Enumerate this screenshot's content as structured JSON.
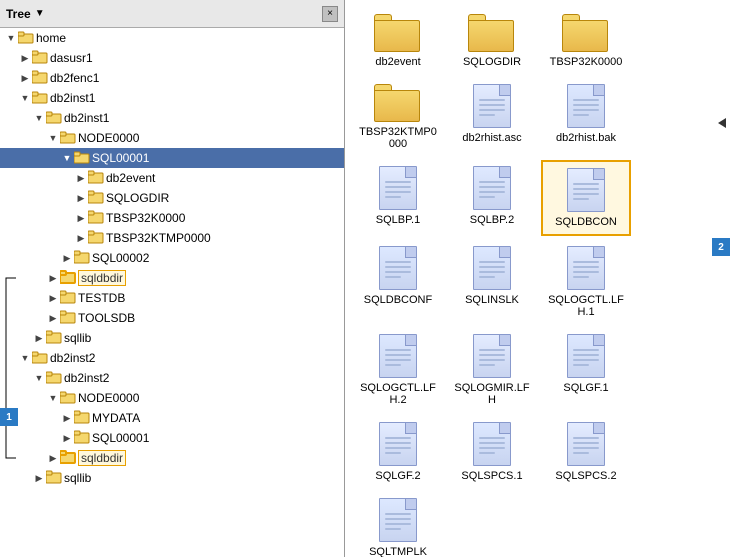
{
  "tree": {
    "title": "Tree",
    "close_label": "×",
    "items": [
      {
        "id": "home",
        "label": "home",
        "indent": 0,
        "expanded": true,
        "type": "folder-open",
        "expander": "▼"
      },
      {
        "id": "dasusr1",
        "label": "dasusr1",
        "indent": 1,
        "expanded": false,
        "type": "folder",
        "expander": "▶"
      },
      {
        "id": "db2fenc1",
        "label": "db2fenc1",
        "indent": 1,
        "expanded": false,
        "type": "folder",
        "expander": "▶"
      },
      {
        "id": "db2inst1_top",
        "label": "db2inst1",
        "indent": 1,
        "expanded": true,
        "type": "folder-open",
        "expander": "▼"
      },
      {
        "id": "db2inst1_inner",
        "label": "db2inst1",
        "indent": 2,
        "expanded": true,
        "type": "folder-open",
        "expander": "▼"
      },
      {
        "id": "node0000_top",
        "label": "NODE0000",
        "indent": 3,
        "expanded": true,
        "type": "folder-open",
        "expander": "▼"
      },
      {
        "id": "sql00001",
        "label": "SQL00001",
        "indent": 4,
        "expanded": true,
        "type": "folder-open",
        "expander": "▼",
        "selected": true
      },
      {
        "id": "db2event",
        "label": "db2event",
        "indent": 5,
        "expanded": false,
        "type": "folder",
        "expander": "▶"
      },
      {
        "id": "sqlogdir",
        "label": "SQLOGDIR",
        "indent": 5,
        "expanded": false,
        "type": "folder",
        "expander": "▶"
      },
      {
        "id": "tbsp32k0000",
        "label": "TBSP32K0000",
        "indent": 5,
        "expanded": false,
        "type": "folder",
        "expander": "▶"
      },
      {
        "id": "tbsp32ktmp0000",
        "label": "TBSP32KTMP0000",
        "indent": 5,
        "expanded": false,
        "type": "folder",
        "expander": "▶"
      },
      {
        "id": "sql00002",
        "label": "SQL00002",
        "indent": 4,
        "expanded": false,
        "type": "folder",
        "expander": "▶"
      },
      {
        "id": "sqldbdir",
        "label": "sqldbdir",
        "indent": 3,
        "expanded": false,
        "type": "folder",
        "expander": "▶",
        "highlighted": true
      },
      {
        "id": "testdb",
        "label": "TESTDB",
        "indent": 3,
        "expanded": false,
        "type": "folder",
        "expander": "▶"
      },
      {
        "id": "toolsdb",
        "label": "TOOLSDB",
        "indent": 3,
        "expanded": false,
        "type": "folder",
        "expander": "▶"
      },
      {
        "id": "sqllib_top",
        "label": "sqllib",
        "indent": 2,
        "expanded": false,
        "type": "folder",
        "expander": "▶"
      },
      {
        "id": "db2inst2_top",
        "label": "db2inst2",
        "indent": 1,
        "expanded": true,
        "type": "folder-open",
        "expander": "▼"
      },
      {
        "id": "db2inst2_inner",
        "label": "db2inst2",
        "indent": 2,
        "expanded": true,
        "type": "folder-open",
        "expander": "▼"
      },
      {
        "id": "node0000_bot",
        "label": "NODE0000",
        "indent": 3,
        "expanded": true,
        "type": "folder-open",
        "expander": "▼"
      },
      {
        "id": "mydata",
        "label": "MYDATA",
        "indent": 4,
        "expanded": false,
        "type": "folder",
        "expander": "▶"
      },
      {
        "id": "sql00001_bot",
        "label": "SQL00001",
        "indent": 4,
        "expanded": false,
        "type": "folder",
        "expander": "▶"
      },
      {
        "id": "sqldbdir_bot",
        "label": "sqldbdir",
        "indent": 3,
        "expanded": false,
        "type": "folder",
        "expander": "▶",
        "highlighted": true
      },
      {
        "id": "sqllib_bot",
        "label": "sqllib",
        "indent": 2,
        "expanded": false,
        "type": "folder",
        "expander": "▶"
      }
    ]
  },
  "files": [
    {
      "id": "db2event",
      "label": "db2event",
      "type": "folder"
    },
    {
      "id": "sqlogdir",
      "label": "SQLOGDIR",
      "type": "folder"
    },
    {
      "id": "tbsp32k0000",
      "label": "TBSP32K0000",
      "type": "folder"
    },
    {
      "id": "tbsp32ktmp0000",
      "label": "TBSP32KTMP0000",
      "type": "folder"
    },
    {
      "id": "db2rhist_asc",
      "label": "db2rhist.asc",
      "type": "doc"
    },
    {
      "id": "db2rhist_bak",
      "label": "db2rhist.bak",
      "type": "doc"
    },
    {
      "id": "sqlbp1",
      "label": "SQLBP.1",
      "type": "doc"
    },
    {
      "id": "sqlbp2",
      "label": "SQLBP.2",
      "type": "doc"
    },
    {
      "id": "sqldbcon",
      "label": "SQLDBCON",
      "type": "doc",
      "selected": true
    },
    {
      "id": "sqldbconf",
      "label": "SQLDBCONF",
      "type": "doc"
    },
    {
      "id": "sqlinslk",
      "label": "SQLINSLK",
      "type": "doc"
    },
    {
      "id": "sqlogctl_lfh1",
      "label": "SQLOGCTL.LFH.1",
      "type": "doc"
    },
    {
      "id": "sqlogctl_lfh2",
      "label": "SQLOGCTL.LFH.2",
      "type": "doc"
    },
    {
      "id": "sqlogmir_lfh",
      "label": "SQLOGMIR.LFH",
      "type": "doc"
    },
    {
      "id": "sqlgf1",
      "label": "SQLGF.1",
      "type": "doc"
    },
    {
      "id": "sqlgf2",
      "label": "SQLGF.2",
      "type": "doc"
    },
    {
      "id": "sqlspcs1",
      "label": "SQLSPCS.1",
      "type": "doc"
    },
    {
      "id": "sqlspcs2",
      "label": "SQLSPCS.2",
      "type": "doc"
    },
    {
      "id": "sqltmplk",
      "label": "SQLTMPLK",
      "type": "doc"
    }
  ],
  "badges": {
    "badge1": "1",
    "badge2": "2"
  }
}
